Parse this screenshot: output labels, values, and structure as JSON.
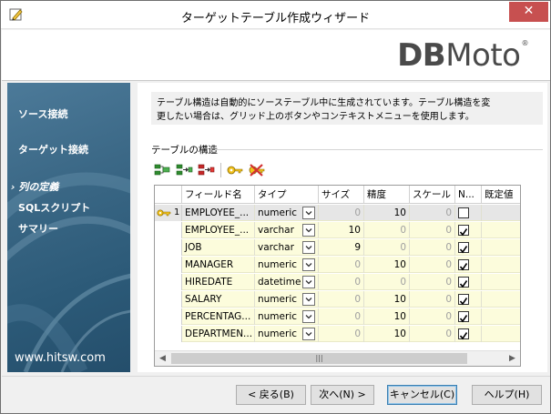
{
  "window": {
    "title": "ターゲットテーブル作成ウィザード",
    "close_glyph": "✕"
  },
  "brand": {
    "logo_bold": "DB",
    "logo_rest": "Moto",
    "reg_mark": "®"
  },
  "sidebar": {
    "items": [
      {
        "label": "ソース接続",
        "active": false
      },
      {
        "label": "ターゲット接続",
        "active": false
      },
      {
        "label": "列の定義",
        "active": true,
        "marker": "›"
      },
      {
        "label": "SQLスクリプト",
        "active": false
      },
      {
        "label": "サマリー",
        "active": false
      }
    ],
    "url": "www.hitsw.com"
  },
  "content": {
    "description_line1": "テーブル構造は自動的にソーステーブル中に生成されています。テーブル構造を変",
    "description_line2": "更したい場合は、グリッド上のボタンやコンテキストメニューを使用します。",
    "group_label": "テーブルの構造"
  },
  "toolbar": {
    "icons": [
      "add-column-icon",
      "insert-column-icon",
      "delete-column-icon",
      "set-key-icon",
      "remove-key-icon"
    ]
  },
  "grid": {
    "headers": [
      "フィールド名",
      "タイプ",
      "サイズ",
      "精度",
      "スケール",
      "N...",
      "既定値"
    ],
    "rows": [
      {
        "key": true,
        "index": "1",
        "field": "EMPLOYEE_...",
        "type": "numeric",
        "size": "0",
        "precision": "10",
        "scale": "0",
        "nullable": false
      },
      {
        "key": false,
        "index": "",
        "field": "EMPLOYEE_...",
        "type": "varchar",
        "size": "10",
        "precision": "0",
        "scale": "0",
        "nullable": true
      },
      {
        "key": false,
        "index": "",
        "field": "JOB",
        "type": "varchar",
        "size": "9",
        "precision": "0",
        "scale": "0",
        "nullable": true
      },
      {
        "key": false,
        "index": "",
        "field": "MANAGER",
        "type": "numeric",
        "size": "0",
        "precision": "10",
        "scale": "0",
        "nullable": true
      },
      {
        "key": false,
        "index": "",
        "field": "HIREDATE",
        "type": "datetime",
        "size": "0",
        "precision": "0",
        "scale": "0",
        "nullable": true
      },
      {
        "key": false,
        "index": "",
        "field": "SALARY",
        "type": "numeric",
        "size": "0",
        "precision": "10",
        "scale": "0",
        "nullable": true
      },
      {
        "key": false,
        "index": "",
        "field": "PERCENTAG...",
        "type": "numeric",
        "size": "0",
        "precision": "10",
        "scale": "0",
        "nullable": true
      },
      {
        "key": false,
        "index": "",
        "field": "DEPARTMEN...",
        "type": "numeric",
        "size": "0",
        "precision": "10",
        "scale": "0",
        "nullable": true
      }
    ],
    "scroll": {
      "left_arrow": "◀",
      "right_arrow": "▶",
      "thumb_grip": "|||"
    }
  },
  "buttons": {
    "back": "< 戻る(B)",
    "next": "次へ(N) >",
    "cancel": "キャンセル(C)",
    "help": "ヘルプ(H)"
  },
  "colors": {
    "sidebar": "#2c5a78",
    "row_bg": "#fcfcdc",
    "close": "#c75050",
    "key_gold": "#e6b800"
  }
}
